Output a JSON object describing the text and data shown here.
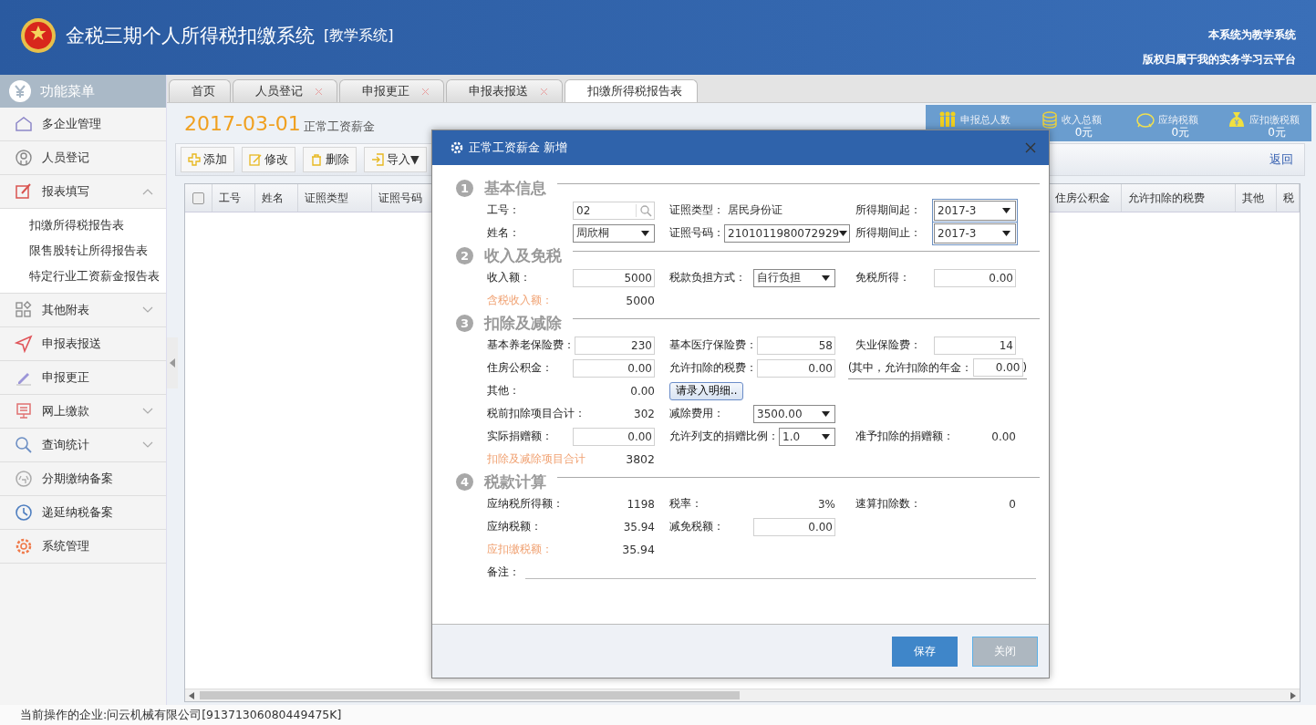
{
  "header": {
    "title": "金税三期个人所得税扣缴系统",
    "subtitle": "[教学系统]",
    "notes": [
      "本系统为教学系统",
      "版权归属于我的实务学习云平台"
    ]
  },
  "sidebar": {
    "title": "功能菜单",
    "items": [
      {
        "label": "多企业管理"
      },
      {
        "label": "人员登记"
      },
      {
        "label": "报表填写",
        "expanded": true,
        "children": [
          {
            "label": "扣缴所得税报告表"
          },
          {
            "label": "限售股转让所得报告表"
          },
          {
            "label": "特定行业工资薪金报告表"
          }
        ]
      },
      {
        "label": "其他附表",
        "expanded": false
      },
      {
        "label": "申报表报送"
      },
      {
        "label": "申报更正"
      },
      {
        "label": "网上缴款",
        "expanded": false
      },
      {
        "label": "查询统计",
        "expanded": false
      },
      {
        "label": "分期缴纳备案"
      },
      {
        "label": "递延纳税备案"
      },
      {
        "label": "系统管理"
      }
    ]
  },
  "tabs": [
    {
      "label": "首页",
      "closable": false,
      "selected": false
    },
    {
      "label": "人员登记",
      "closable": true,
      "selected": false
    },
    {
      "label": "申报更正",
      "closable": true,
      "selected": false
    },
    {
      "label": "申报表报送",
      "closable": true,
      "selected": false
    },
    {
      "label": "扣缴所得税报告表",
      "closable": false,
      "selected": true
    }
  ],
  "page": {
    "date": "2017-03-01",
    "subtitle": "正常工资薪金",
    "back_link": "返回"
  },
  "summary": [
    {
      "label": "申报总人数"
    },
    {
      "label": "收入总额",
      "value": "0元"
    },
    {
      "label": "应纳税额",
      "value": "0元"
    },
    {
      "label": "应扣缴税额",
      "value": "0元"
    }
  ],
  "toolbar": [
    "添加",
    "修改",
    "删除",
    "导入▼"
  ],
  "table": {
    "select_all_checked": false,
    "columns_left": [
      "工号",
      "姓名",
      "证照类型",
      "证照号码"
    ],
    "columns_right": [
      "住房公积金",
      "允许扣除的税费",
      "其他",
      "税"
    ]
  },
  "status_bar": "当前操作的企业:问云机械有限公司[91371306080449475K]",
  "dialog": {
    "title": "正常工资薪金 新增",
    "sections": [
      {
        "number": "1",
        "title": "基本信息",
        "rows": [
          [
            [
              {
                "kind": "label",
                "text": "工号："
              },
              {
                "kind": "search",
                "value": "02"
              }
            ],
            [
              {
                "kind": "label",
                "text": "证照类型："
              },
              {
                "kind": "info",
                "text": "居民身份证"
              }
            ],
            [
              {
                "kind": "label",
                "text": "所得期间起："
              },
              {
                "kind": "period",
                "value": "2017-3"
              }
            ]
          ],
          [
            [
              {
                "kind": "label",
                "text": "姓名："
              },
              {
                "kind": "select",
                "value": "周欣桐"
              }
            ],
            [
              {
                "kind": "label",
                "text": "证照号码："
              },
              {
                "kind": "wideselect",
                "value": "2101011980072929"
              }
            ],
            [
              {
                "kind": "label",
                "text": "所得期间止："
              },
              {
                "kind": "period",
                "value": "2017-3"
              }
            ]
          ]
        ]
      },
      {
        "number": "2",
        "title": "收入及免税",
        "rows": [
          [
            [
              {
                "kind": "label",
                "text": "收入额："
              },
              {
                "kind": "input",
                "value": "5000"
              }
            ],
            [
              {
                "kind": "label",
                "text": "税款负担方式："
              },
              {
                "kind": "select",
                "value": "自行负担"
              }
            ],
            [
              {
                "kind": "label",
                "text": "免税所得："
              },
              {
                "kind": "input",
                "value": "0.00"
              }
            ]
          ],
          [
            [
              {
                "kind": "total",
                "text": "含税收入额："
              },
              {
                "kind": "totalvalue",
                "text": "5000"
              }
            ]
          ]
        ]
      },
      {
        "number": "3",
        "title": "扣除及减除",
        "rows": [
          [
            [
              {
                "kind": "label",
                "text": "基本养老保险费："
              },
              {
                "kind": "input",
                "value": "230"
              }
            ],
            [
              {
                "kind": "label",
                "text": "基本医疗保险费："
              },
              {
                "kind": "input",
                "value": "58"
              }
            ],
            [
              {
                "kind": "label",
                "text": "失业保险费："
              },
              {
                "kind": "input",
                "value": "14"
              }
            ]
          ],
          [
            [
              {
                "kind": "label",
                "text": "住房公积金："
              },
              {
                "kind": "input",
                "value": "0.00"
              }
            ],
            [
              {
                "kind": "label",
                "text": "允许扣除的税费："
              },
              {
                "kind": "input",
                "value": "0.00"
              }
            ],
            [
              {
                "kind": "label",
                "text": "(其中，允许扣除的年金："
              },
              {
                "kind": "smallinput",
                "value": "0.00"
              },
              {
                "kind": "label",
                "text": ")"
              }
            ]
          ],
          [
            [
              {
                "kind": "label",
                "text": "其他："
              },
              {
                "kind": "text",
                "text": "0.00"
              }
            ],
            [
              {
                "kind": "button",
                "text": "请录入明细.."
              }
            ]
          ],
          [
            [
              {
                "kind": "label",
                "text": "税前扣除项目合计："
              },
              {
                "kind": "text",
                "text": "302"
              }
            ],
            [
              {
                "kind": "label",
                "text": "减除费用："
              },
              {
                "kind": "select",
                "value": "3500.00"
              }
            ]
          ],
          [
            [
              {
                "kind": "label",
                "text": "实际捐赠额："
              },
              {
                "kind": "input",
                "value": "0.00"
              }
            ],
            [
              {
                "kind": "label",
                "text": "允许列支的捐赠比例："
              },
              {
                "kind": "narrowselect",
                "value": "1.0"
              }
            ],
            [
              {
                "kind": "label",
                "text": "准予扣除的捐赠额："
              },
              {
                "kind": "text",
                "text": "0.00"
              }
            ]
          ],
          [
            [
              {
                "kind": "total",
                "text": "扣除及减除项目合计"
              },
              {
                "kind": "totalvalue",
                "text": "3802"
              }
            ]
          ]
        ]
      },
      {
        "number": "4",
        "title": "税款计算",
        "rows": [
          [
            [
              {
                "kind": "label",
                "text": "应纳税所得额："
              },
              {
                "kind": "text",
                "text": "1198"
              }
            ],
            [
              {
                "kind": "label",
                "text": "税率："
              },
              {
                "kind": "text",
                "text": "3%"
              }
            ],
            [
              {
                "kind": "label",
                "text": "速算扣除数："
              },
              {
                "kind": "text",
                "text": "0"
              }
            ]
          ],
          [
            [
              {
                "kind": "label",
                "text": "应纳税额："
              },
              {
                "kind": "text",
                "text": "35.94"
              }
            ],
            [
              {
                "kind": "label",
                "text": "减免税额："
              },
              {
                "kind": "input",
                "value": "0.00"
              }
            ]
          ],
          [
            [
              {
                "kind": "total",
                "text": "应扣缴税额："
              },
              {
                "kind": "totalvalue",
                "text": "35.94"
              }
            ]
          ],
          [
            [
              {
                "kind": "label",
                "text": "备注："
              },
              {
                "kind": "line"
              }
            ]
          ]
        ]
      }
    ],
    "buttons": [
      {
        "label": "保存",
        "kind": "primary"
      },
      {
        "label": "关闭",
        "kind": "secondary"
      }
    ]
  }
}
